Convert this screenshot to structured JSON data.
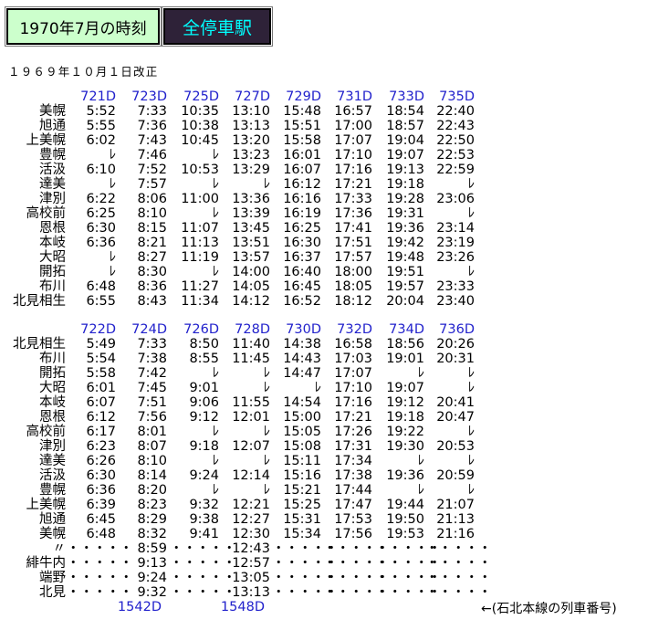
{
  "tabs": {
    "timetable_title": "1970年7月の時刻",
    "all_stations": "全停車駅"
  },
  "revision_note": "１９６９年１０月１日改正",
  "sections": [
    {
      "train_numbers": [
        "721D",
        "723D",
        "725D",
        "727D",
        "729D",
        "731D",
        "733D",
        "735D"
      ],
      "rows": [
        {
          "station": "美幌",
          "times": [
            "5:52",
            "7:33",
            "10:35",
            "13:10",
            "15:48",
            "16:57",
            "18:54",
            "22:40"
          ]
        },
        {
          "station": "旭通",
          "times": [
            "5:55",
            "7:36",
            "10:38",
            "13:13",
            "15:51",
            "17:00",
            "18:57",
            "22:43"
          ]
        },
        {
          "station": "上美幌",
          "times": [
            "6:02",
            "7:43",
            "10:45",
            "13:20",
            "15:58",
            "17:07",
            "19:04",
            "22:50"
          ]
        },
        {
          "station": "豊幌",
          "times": [
            "ﾚ",
            "7:46",
            "ﾚ",
            "13:23",
            "16:01",
            "17:10",
            "19:07",
            "22:53"
          ]
        },
        {
          "station": "活汲",
          "times": [
            "6:10",
            "7:52",
            "10:53",
            "13:29",
            "16:07",
            "17:16",
            "19:13",
            "22:59"
          ]
        },
        {
          "station": "達美",
          "times": [
            "ﾚ",
            "7:57",
            "ﾚ",
            "ﾚ",
            "16:12",
            "17:21",
            "19:18",
            "ﾚ"
          ]
        },
        {
          "station": "津別",
          "times": [
            "6:22",
            "8:06",
            "11:00",
            "13:36",
            "16:16",
            "17:33",
            "19:28",
            "23:06"
          ]
        },
        {
          "station": "高校前",
          "times": [
            "6:25",
            "8:10",
            "ﾚ",
            "13:39",
            "16:19",
            "17:36",
            "19:31",
            "ﾚ"
          ]
        },
        {
          "station": "恩根",
          "times": [
            "6:30",
            "8:15",
            "11:07",
            "13:45",
            "16:25",
            "17:41",
            "19:36",
            "23:14"
          ]
        },
        {
          "station": "本岐",
          "times": [
            "6:36",
            "8:21",
            "11:13",
            "13:51",
            "16:30",
            "17:51",
            "19:42",
            "23:19"
          ]
        },
        {
          "station": "大昭",
          "times": [
            "ﾚ",
            "8:27",
            "11:19",
            "13:57",
            "16:37",
            "17:57",
            "19:48",
            "23:26"
          ]
        },
        {
          "station": "開拓",
          "times": [
            "ﾚ",
            "8:30",
            "ﾚ",
            "14:00",
            "16:40",
            "18:00",
            "19:51",
            "ﾚ"
          ]
        },
        {
          "station": "布川",
          "times": [
            "6:48",
            "8:36",
            "11:27",
            "14:05",
            "16:45",
            "18:05",
            "19:57",
            "23:33"
          ]
        },
        {
          "station": "北見相生",
          "times": [
            "6:55",
            "8:43",
            "11:34",
            "14:12",
            "16:52",
            "18:12",
            "20:04",
            "23:40"
          ]
        }
      ]
    },
    {
      "train_numbers": [
        "722D",
        "724D",
        "726D",
        "728D",
        "730D",
        "732D",
        "734D",
        "736D"
      ],
      "rows": [
        {
          "station": "北見相生",
          "times": [
            "5:49",
            "7:33",
            "8:50",
            "11:40",
            "14:38",
            "16:58",
            "18:56",
            "20:26"
          ]
        },
        {
          "station": "布川",
          "times": [
            "5:54",
            "7:38",
            "8:55",
            "11:45",
            "14:43",
            "17:03",
            "19:01",
            "20:31"
          ]
        },
        {
          "station": "開拓",
          "times": [
            "5:58",
            "7:42",
            "ﾚ",
            "ﾚ",
            "14:47",
            "17:07",
            "ﾚ",
            "ﾚ"
          ]
        },
        {
          "station": "大昭",
          "times": [
            "6:01",
            "7:45",
            "9:01",
            "ﾚ",
            "ﾚ",
            "17:10",
            "19:07",
            "ﾚ"
          ]
        },
        {
          "station": "本岐",
          "times": [
            "6:07",
            "7:51",
            "9:06",
            "11:55",
            "14:54",
            "17:16",
            "19:12",
            "20:41"
          ]
        },
        {
          "station": "恩根",
          "times": [
            "6:12",
            "7:56",
            "9:12",
            "12:01",
            "15:00",
            "17:21",
            "19:18",
            "20:47"
          ]
        },
        {
          "station": "高校前",
          "times": [
            "6:17",
            "8:01",
            "ﾚ",
            "ﾚ",
            "15:05",
            "17:26",
            "19:22",
            "ﾚ"
          ]
        },
        {
          "station": "津別",
          "times": [
            "6:23",
            "8:07",
            "9:18",
            "12:07",
            "15:08",
            "17:31",
            "19:30",
            "20:53"
          ]
        },
        {
          "station": "達美",
          "times": [
            "6:26",
            "8:10",
            "ﾚ",
            "ﾚ",
            "15:11",
            "17:34",
            "ﾚ",
            "ﾚ"
          ]
        },
        {
          "station": "活汲",
          "times": [
            "6:30",
            "8:14",
            "9:24",
            "12:14",
            "15:16",
            "17:38",
            "19:36",
            "20:59"
          ]
        },
        {
          "station": "豊幌",
          "times": [
            "6:36",
            "8:20",
            "ﾚ",
            "ﾚ",
            "15:21",
            "17:44",
            "ﾚ",
            "ﾚ"
          ]
        },
        {
          "station": "上美幌",
          "times": [
            "6:39",
            "8:23",
            "9:32",
            "12:21",
            "15:25",
            "17:47",
            "19:44",
            "21:07"
          ]
        },
        {
          "station": "旭通",
          "times": [
            "6:45",
            "8:29",
            "9:38",
            "12:27",
            "15:31",
            "17:53",
            "19:50",
            "21:13"
          ]
        },
        {
          "station": "美幌",
          "times": [
            "6:48",
            "8:32",
            "9:41",
            "12:30",
            "15:34",
            "17:56",
            "19:53",
            "21:16"
          ]
        },
        {
          "station": "〃",
          "times": [
            "・・・・・",
            "8:59",
            "・・・・・",
            "12:43",
            "・・・・・",
            "・・・・・",
            "・・・・・",
            "・・・・・"
          ]
        },
        {
          "station": "緋牛内",
          "times": [
            "・・・・・",
            "9:13",
            "・・・・・",
            "12:57",
            "・・・・・",
            "・・・・・",
            "・・・・・",
            "・・・・・"
          ]
        },
        {
          "station": "端野",
          "times": [
            "・・・・・",
            "9:24",
            "・・・・・",
            "13:05",
            "・・・・・",
            "・・・・・",
            "・・・・・",
            "・・・・・"
          ]
        },
        {
          "station": "北見",
          "times": [
            "・・・・・",
            "9:32",
            "・・・・・",
            "13:13",
            "・・・・・",
            "・・・・・",
            "・・・・・",
            "・・・・・"
          ]
        }
      ],
      "footer_numbers": [
        "",
        "1542D",
        "",
        "1548D",
        "",
        "",
        "",
        ""
      ]
    }
  ],
  "note": "←(石北本線の列車番号)",
  "colors": {
    "train_number": "#2222cc",
    "tab_a_bg": "#ccffcc",
    "tab_b_bg": "#2e2238",
    "tab_b_text": "#00ffff"
  }
}
